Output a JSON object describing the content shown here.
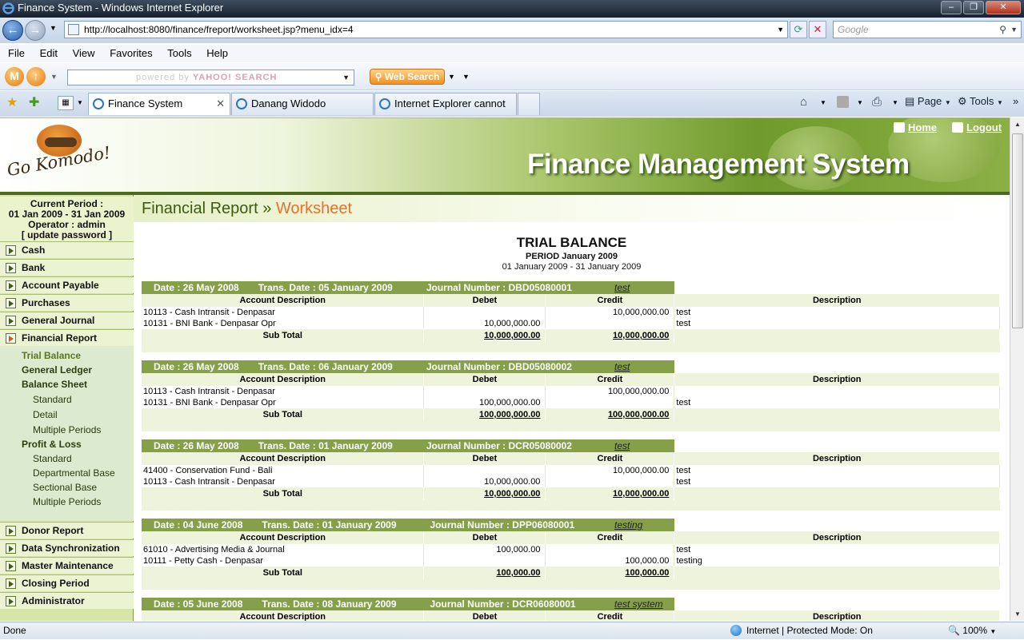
{
  "browser": {
    "window_title": "Finance System - Windows Internet Explorer",
    "url": "http://localhost:8080/finance/freport/worksheet.jsp?menu_idx=4",
    "search_placeholder": "Google",
    "menu": [
      "File",
      "Edit",
      "View",
      "Favorites",
      "Tools",
      "Help"
    ],
    "yahoo_powered": "powered by",
    "yahoo_brand": "YAHOO! SEARCH",
    "web_search_label": "Web Search",
    "tabs": [
      {
        "label": "Finance System",
        "active": true
      },
      {
        "label": "Danang Widodo",
        "active": false
      },
      {
        "label": "Internet Explorer cannot di...",
        "active": false
      }
    ],
    "toolbar": {
      "page": "Page",
      "tools": "Tools"
    },
    "status": {
      "done": "Done",
      "zone": "Internet | Protected Mode: On",
      "zoom": "100%"
    }
  },
  "header": {
    "logo_text": "Go Komodo!",
    "title": "Finance Management System",
    "home": "Home",
    "logout": "Logout"
  },
  "sidebar": {
    "period_label": "Current Period :",
    "period_value": "01 Jan 2009 - 31 Jan 2009",
    "operator": "Operator : admin",
    "update_password": "[ update password ]",
    "menu_top": [
      "Cash",
      "Bank",
      "Account Payable",
      "Purchases",
      "General Journal",
      "Financial Report"
    ],
    "sub_items": [
      {
        "label": "Trial Balance",
        "level": 1
      },
      {
        "label": "General Ledger",
        "level": 1
      },
      {
        "label": "Balance Sheet",
        "level": 1
      },
      {
        "label": "Standard",
        "level": 2
      },
      {
        "label": "Detail",
        "level": 2
      },
      {
        "label": "Multiple Periods",
        "level": 2
      },
      {
        "label": "Profit & Loss",
        "level": 1
      },
      {
        "label": "Standard",
        "level": 2
      },
      {
        "label": "Departmental Base",
        "level": 2
      },
      {
        "label": "Sectional Base",
        "level": 2
      },
      {
        "label": "Multiple Periods",
        "level": 2
      }
    ],
    "menu_bottom": [
      "Donor Report",
      "Data Synchronization",
      "Master Maintenance",
      "Closing Period",
      "Administrator"
    ]
  },
  "breadcrumb": {
    "section": "Financial Report",
    "separator": "»",
    "page": "Worksheet"
  },
  "report": {
    "title": "TRIAL BALANCE",
    "period": "PERIOD January 2009",
    "range": "01 January 2009 - 31 January 2009",
    "columns": [
      "Account Description",
      "Debet",
      "Credit",
      "Description"
    ],
    "subtotal_label": "Sub Total",
    "journals": [
      {
        "date": "Date : 26 May 2008",
        "trans": "Trans. Date : 05 January 2009",
        "journal": "Journal Number : DBD05080001",
        "note": "test",
        "rows": [
          {
            "acc": "10113 - Cash Intransit - Denpasar",
            "debet": "",
            "credit": "10,000,000.00",
            "desc": "test"
          },
          {
            "acc": "10131 - BNI Bank - Denpasar Opr",
            "debet": "10,000,000.00",
            "credit": "",
            "desc": "test"
          }
        ],
        "sub_debet": "10,000,000.00",
        "sub_credit": "10,000,000.00"
      },
      {
        "date": "Date : 26 May 2008",
        "trans": "Trans. Date : 06 January 2009",
        "journal": "Journal Number : DBD05080002",
        "note": "test",
        "rows": [
          {
            "acc": "10113 - Cash Intransit - Denpasar",
            "debet": "",
            "credit": "100,000,000.00",
            "desc": ""
          },
          {
            "acc": "10131 - BNI Bank - Denpasar Opr",
            "debet": "100,000,000.00",
            "credit": "",
            "desc": "test"
          }
        ],
        "sub_debet": "100,000,000.00",
        "sub_credit": "100,000,000.00"
      },
      {
        "date": "Date : 26 May 2008",
        "trans": "Trans. Date : 01 January 2009",
        "journal": "Journal Number : DCR05080002",
        "note": "test",
        "rows": [
          {
            "acc": "41400 - Conservation Fund - Bali",
            "debet": "",
            "credit": "10,000,000.00",
            "desc": "test"
          },
          {
            "acc": "10113 - Cash Intransit - Denpasar",
            "debet": "10,000,000.00",
            "credit": "",
            "desc": "test"
          }
        ],
        "sub_debet": "10,000,000.00",
        "sub_credit": "10,000,000.00"
      },
      {
        "date": "Date : 04 June 2008",
        "trans": "Trans. Date : 01 January 2009",
        "journal": "Journal Number : DPP06080001",
        "note": "testing",
        "rows": [
          {
            "acc": "61010 - Advertising Media & Journal",
            "debet": "100,000.00",
            "credit": "",
            "desc": "test"
          },
          {
            "acc": "10111 - Petty Cash - Denpasar",
            "debet": "",
            "credit": "100,000.00",
            "desc": "testing"
          }
        ],
        "sub_debet": "100,000.00",
        "sub_credit": "100,000.00"
      },
      {
        "date": "Date : 05 June 2008",
        "trans": "Trans. Date : 08 January 2009",
        "journal": "Journal Number : DCR06080001",
        "note": "test system",
        "rows": [],
        "sub_debet": "",
        "sub_credit": ""
      }
    ]
  }
}
